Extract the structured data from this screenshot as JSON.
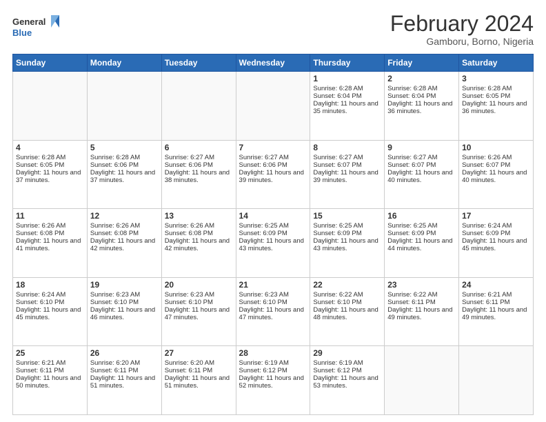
{
  "header": {
    "logo_line1": "General",
    "logo_line2": "Blue",
    "month_year": "February 2024",
    "location": "Gamboru, Borno, Nigeria"
  },
  "weekdays": [
    "Sunday",
    "Monday",
    "Tuesday",
    "Wednesday",
    "Thursday",
    "Friday",
    "Saturday"
  ],
  "weeks": [
    [
      {
        "day": "",
        "info": ""
      },
      {
        "day": "",
        "info": ""
      },
      {
        "day": "",
        "info": ""
      },
      {
        "day": "",
        "info": ""
      },
      {
        "day": "1",
        "info": "Sunrise: 6:28 AM\nSunset: 6:04 PM\nDaylight: 11 hours and 35 minutes."
      },
      {
        "day": "2",
        "info": "Sunrise: 6:28 AM\nSunset: 6:04 PM\nDaylight: 11 hours and 36 minutes."
      },
      {
        "day": "3",
        "info": "Sunrise: 6:28 AM\nSunset: 6:05 PM\nDaylight: 11 hours and 36 minutes."
      }
    ],
    [
      {
        "day": "4",
        "info": "Sunrise: 6:28 AM\nSunset: 6:05 PM\nDaylight: 11 hours and 37 minutes."
      },
      {
        "day": "5",
        "info": "Sunrise: 6:28 AM\nSunset: 6:06 PM\nDaylight: 11 hours and 37 minutes."
      },
      {
        "day": "6",
        "info": "Sunrise: 6:27 AM\nSunset: 6:06 PM\nDaylight: 11 hours and 38 minutes."
      },
      {
        "day": "7",
        "info": "Sunrise: 6:27 AM\nSunset: 6:06 PM\nDaylight: 11 hours and 39 minutes."
      },
      {
        "day": "8",
        "info": "Sunrise: 6:27 AM\nSunset: 6:07 PM\nDaylight: 11 hours and 39 minutes."
      },
      {
        "day": "9",
        "info": "Sunrise: 6:27 AM\nSunset: 6:07 PM\nDaylight: 11 hours and 40 minutes."
      },
      {
        "day": "10",
        "info": "Sunrise: 6:26 AM\nSunset: 6:07 PM\nDaylight: 11 hours and 40 minutes."
      }
    ],
    [
      {
        "day": "11",
        "info": "Sunrise: 6:26 AM\nSunset: 6:08 PM\nDaylight: 11 hours and 41 minutes."
      },
      {
        "day": "12",
        "info": "Sunrise: 6:26 AM\nSunset: 6:08 PM\nDaylight: 11 hours and 42 minutes."
      },
      {
        "day": "13",
        "info": "Sunrise: 6:26 AM\nSunset: 6:08 PM\nDaylight: 11 hours and 42 minutes."
      },
      {
        "day": "14",
        "info": "Sunrise: 6:25 AM\nSunset: 6:09 PM\nDaylight: 11 hours and 43 minutes."
      },
      {
        "day": "15",
        "info": "Sunrise: 6:25 AM\nSunset: 6:09 PM\nDaylight: 11 hours and 43 minutes."
      },
      {
        "day": "16",
        "info": "Sunrise: 6:25 AM\nSunset: 6:09 PM\nDaylight: 11 hours and 44 minutes."
      },
      {
        "day": "17",
        "info": "Sunrise: 6:24 AM\nSunset: 6:09 PM\nDaylight: 11 hours and 45 minutes."
      }
    ],
    [
      {
        "day": "18",
        "info": "Sunrise: 6:24 AM\nSunset: 6:10 PM\nDaylight: 11 hours and 45 minutes."
      },
      {
        "day": "19",
        "info": "Sunrise: 6:23 AM\nSunset: 6:10 PM\nDaylight: 11 hours and 46 minutes."
      },
      {
        "day": "20",
        "info": "Sunrise: 6:23 AM\nSunset: 6:10 PM\nDaylight: 11 hours and 47 minutes."
      },
      {
        "day": "21",
        "info": "Sunrise: 6:23 AM\nSunset: 6:10 PM\nDaylight: 11 hours and 47 minutes."
      },
      {
        "day": "22",
        "info": "Sunrise: 6:22 AM\nSunset: 6:10 PM\nDaylight: 11 hours and 48 minutes."
      },
      {
        "day": "23",
        "info": "Sunrise: 6:22 AM\nSunset: 6:11 PM\nDaylight: 11 hours and 49 minutes."
      },
      {
        "day": "24",
        "info": "Sunrise: 6:21 AM\nSunset: 6:11 PM\nDaylight: 11 hours and 49 minutes."
      }
    ],
    [
      {
        "day": "25",
        "info": "Sunrise: 6:21 AM\nSunset: 6:11 PM\nDaylight: 11 hours and 50 minutes."
      },
      {
        "day": "26",
        "info": "Sunrise: 6:20 AM\nSunset: 6:11 PM\nDaylight: 11 hours and 51 minutes."
      },
      {
        "day": "27",
        "info": "Sunrise: 6:20 AM\nSunset: 6:11 PM\nDaylight: 11 hours and 51 minutes."
      },
      {
        "day": "28",
        "info": "Sunrise: 6:19 AM\nSunset: 6:12 PM\nDaylight: 11 hours and 52 minutes."
      },
      {
        "day": "29",
        "info": "Sunrise: 6:19 AM\nSunset: 6:12 PM\nDaylight: 11 hours and 53 minutes."
      },
      {
        "day": "",
        "info": ""
      },
      {
        "day": "",
        "info": ""
      }
    ]
  ]
}
